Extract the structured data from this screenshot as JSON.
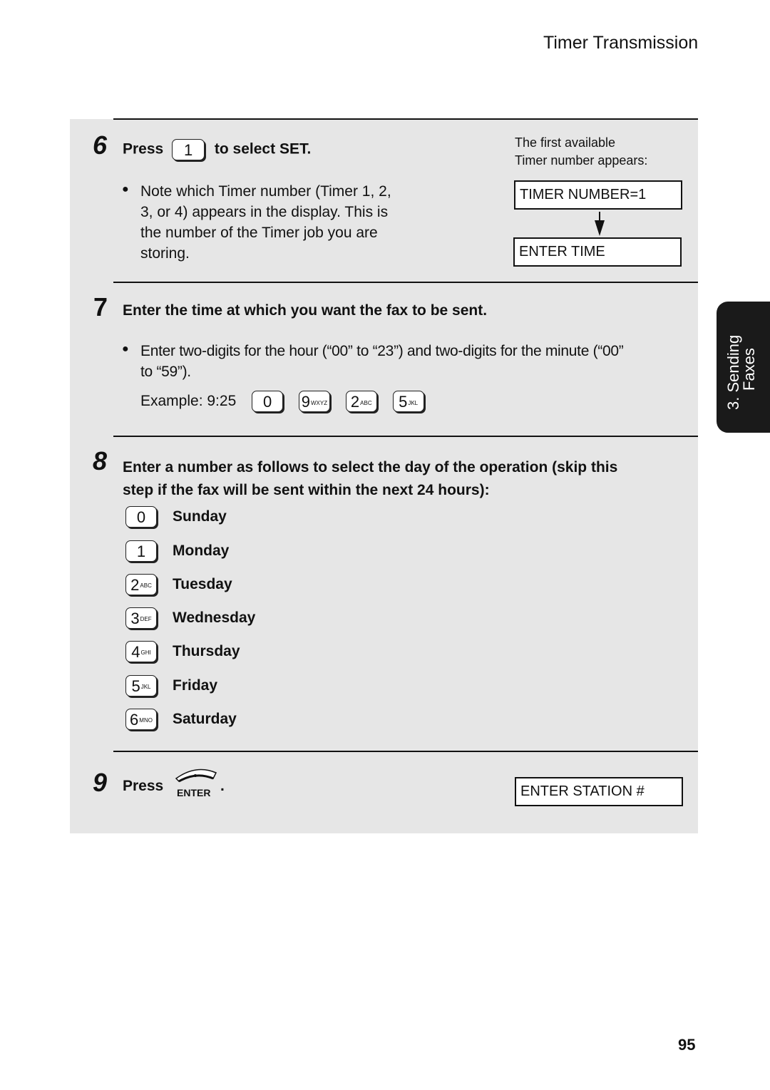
{
  "header": {
    "title": "Timer Transmission"
  },
  "side_tab": {
    "line1": "3. Sending",
    "line2": "Faxes"
  },
  "page_number": "95",
  "steps": {
    "step6": {
      "number": "6",
      "press_label": "Press",
      "key": {
        "digit": "1",
        "letters": ""
      },
      "after_key": "to select SET.",
      "bullet_text_lines": [
        "Note which Timer number (Timer 1, 2,",
        "3, or 4) appears in the display. This is",
        "the number of the Timer job you are",
        "storing."
      ],
      "side_note_lines": [
        "The first available",
        "Timer number appears:"
      ],
      "display1": "TIMER NUMBER=1",
      "display2": "ENTER TIME"
    },
    "step7": {
      "number": "7",
      "heading": "Enter the time at which you want the fax to be sent.",
      "bullet_text_lines": [
        "Enter two-digits for the hour (“00” to “23”) and two-digits for the minute (“00”",
        "to “59”)."
      ],
      "example_label": "Example: 9:25",
      "example_keys": [
        {
          "digit": "0",
          "letters": ""
        },
        {
          "digit": "9",
          "letters": "WXYZ"
        },
        {
          "digit": "2",
          "letters": "ABC"
        },
        {
          "digit": "5",
          "letters": "JKL"
        }
      ]
    },
    "step8": {
      "number": "8",
      "heading_lines": [
        "Enter a number as follows to select the day of the operation (skip this",
        "step if the fax will be sent within the next 24 hours):"
      ],
      "days": [
        {
          "digit": "0",
          "letters": "",
          "day": "Sunday"
        },
        {
          "digit": "1",
          "letters": "",
          "day": "Monday"
        },
        {
          "digit": "2",
          "letters": "ABC",
          "day": "Tuesday"
        },
        {
          "digit": "3",
          "letters": "DEF",
          "day": "Wednesday"
        },
        {
          "digit": "4",
          "letters": "GHI",
          "day": "Thursday"
        },
        {
          "digit": "5",
          "letters": "JKL",
          "day": "Friday"
        },
        {
          "digit": "6",
          "letters": "MNO",
          "day": "Saturday"
        }
      ]
    },
    "step9": {
      "number": "9",
      "press_label": "Press",
      "enter_key_label": "ENTER",
      "period": ".",
      "display": "ENTER STATION #"
    }
  }
}
